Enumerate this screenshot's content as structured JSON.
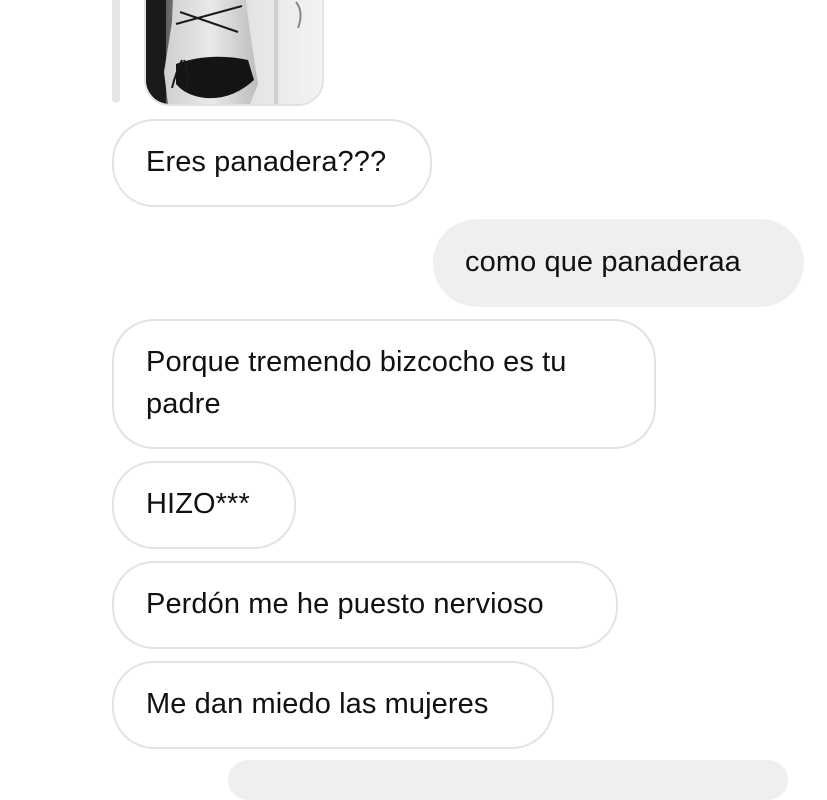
{
  "conversation": {
    "messages": [
      {
        "direction": "received",
        "text": "Eres panadera???"
      },
      {
        "direction": "sent",
        "text": "como que panaderaa"
      },
      {
        "direction": "received",
        "text": "Porque tremendo bizcocho es tu padre"
      },
      {
        "direction": "received",
        "text": "HIZO***"
      },
      {
        "direction": "received",
        "text": "Perdón me he puesto nervioso"
      },
      {
        "direction": "received",
        "text": "Me dan miedo las mujeres"
      }
    ]
  },
  "colors": {
    "received_bubble_bg": "#ffffff",
    "received_bubble_border": "#e3e3e3",
    "sent_bubble_bg": "#efefef",
    "text": "#111111",
    "reply_bar": "#e5e5e5"
  }
}
